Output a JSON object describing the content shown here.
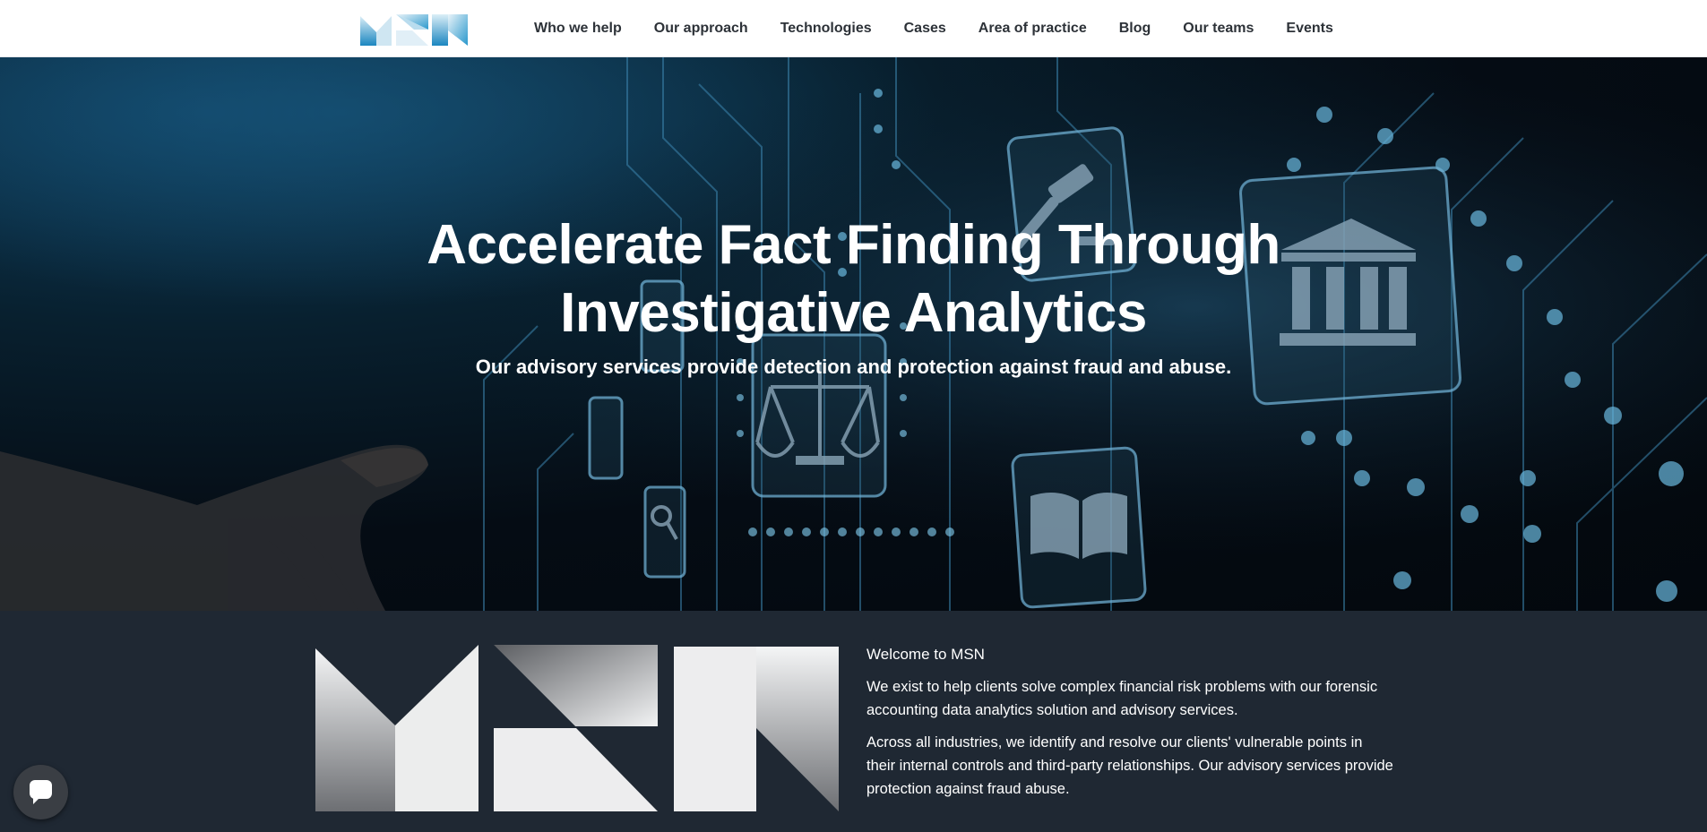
{
  "header": {
    "logo_text": "MSN",
    "nav": [
      "Who we help",
      "Our approach",
      "Technologies",
      "Cases",
      "Area of practice",
      "Blog",
      "Our teams",
      "Events"
    ]
  },
  "hero": {
    "title_line1": "Accelerate Fact Finding Through",
    "title_line2": "Investigative Analytics",
    "subtitle": "Our advisory services provide detection and protection against fraud and abuse."
  },
  "welcome": {
    "logo_text": "MSN",
    "heading": "Welcome to MSN",
    "paragraph1": "We exist to help clients solve complex financial risk problems with our forensic accounting data analytics solution and advisory services.",
    "paragraph2": "Across all industries, we identify and resolve our clients' vulnerable points in their internal controls and third-party relationships. Our advisory services provide protection against fraud abuse."
  },
  "chat": {
    "icon": "chat-bubble-icon"
  },
  "colors": {
    "header_bg": "#ffffff",
    "nav_text": "#2d3238",
    "hero_dark": "#050c14",
    "circuit_glow": "#4fa9d6",
    "section_bg": "#1f2833",
    "logo_blue": "#1e8fc4"
  }
}
